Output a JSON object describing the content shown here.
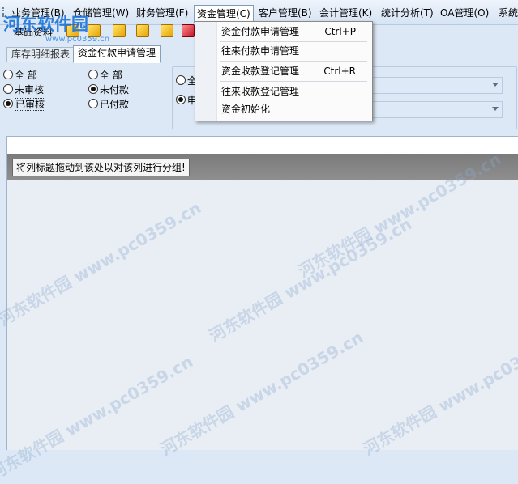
{
  "menubar": {
    "items": [
      "业务管理(B)",
      "仓储管理(W)",
      "财务管理(F)",
      "资金管理(C)",
      "客户管理(B)",
      "会计管理(K)",
      "统计分析(T)",
      "OA管理(O)",
      "系统"
    ]
  },
  "toolbar": {
    "label": "基础资料"
  },
  "tabs": {
    "inactive": "库存明细报表",
    "active": "资金付款申请管理"
  },
  "filters": {
    "left": [
      "全 部",
      "未审核",
      "已审核"
    ],
    "middle": [
      "全 部",
      "未付款",
      "已付款"
    ],
    "right": [
      "全",
      "申"
    ]
  },
  "grid": {
    "group_hint": "将列标题拖动到该处以对该列进行分组!"
  },
  "dropdown": {
    "items": [
      {
        "label": "资金付款申请管理",
        "shortcut": "Ctrl+P"
      },
      {
        "label": "往来付款申请管理",
        "shortcut": ""
      },
      {
        "label": "资金收款登记管理",
        "shortcut": "Ctrl+R"
      },
      {
        "label": "往来收款登记管理",
        "shortcut": ""
      },
      {
        "label": "资金初始化",
        "shortcut": ""
      }
    ]
  },
  "watermark": {
    "logo": "河东软件园",
    "url": "www.pc0359.cn",
    "text": "河东软件园 www.pc0359.cn"
  }
}
